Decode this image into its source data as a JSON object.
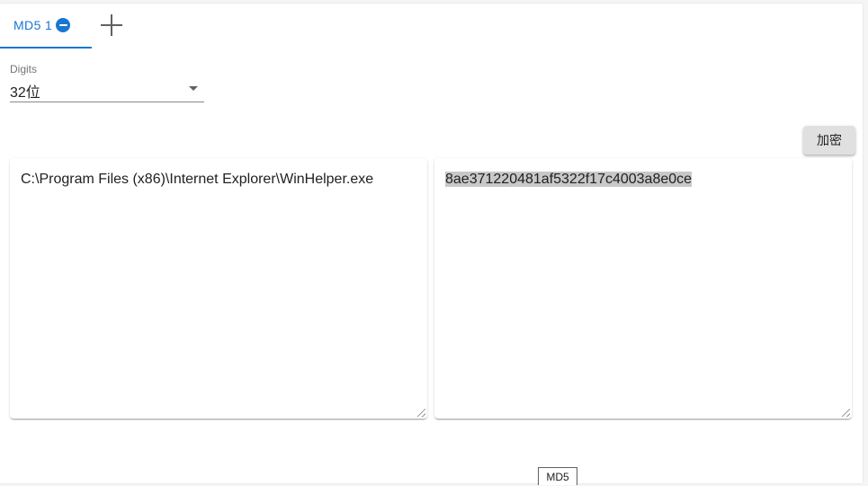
{
  "tabs": [
    {
      "label": "MD5 1",
      "active": true
    }
  ],
  "add_tab_icon": "plus-icon",
  "remove_tab_icon": "minus-circle-icon",
  "digits": {
    "label": "Digits",
    "value": "32位"
  },
  "encrypt_button": {
    "label": "加密"
  },
  "input_panel": {
    "value": "C:\\Program Files (x86)\\Internet Explorer\\WinHelper.exe"
  },
  "output_panel": {
    "value": "8ae371220481af5322f17c4003a8e0ce"
  },
  "footer_tag": {
    "label": "MD5"
  },
  "colors": {
    "accent": "#1976d2",
    "button_bg": "#e0e0e0",
    "selection": "#c8c8c8"
  }
}
